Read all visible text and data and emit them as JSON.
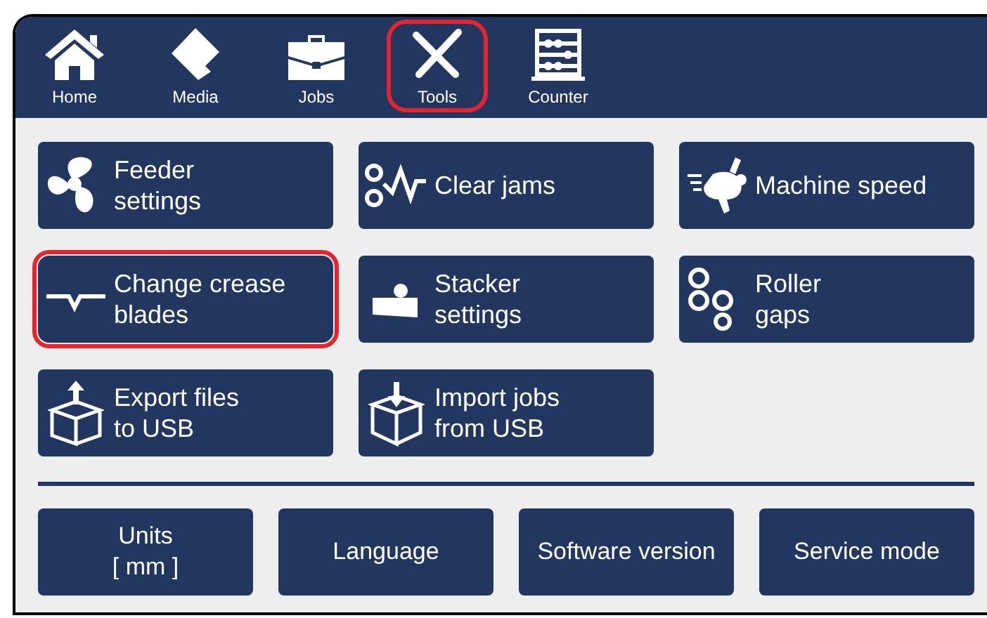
{
  "nav": [
    {
      "label": "Home",
      "highlighted": false
    },
    {
      "label": "Media",
      "highlighted": false
    },
    {
      "label": "Jobs",
      "highlighted": false
    },
    {
      "label": "Tools",
      "highlighted": true
    },
    {
      "label": "Counter",
      "highlighted": false
    }
  ],
  "tools": [
    {
      "lines": [
        "Feeder",
        "settings"
      ],
      "highlighted": false
    },
    {
      "lines": [
        "Clear jams"
      ],
      "highlighted": false
    },
    {
      "lines": [
        "Machine speed"
      ],
      "highlighted": false
    },
    {
      "lines": [
        "Change crease",
        "blades"
      ],
      "highlighted": true
    },
    {
      "lines": [
        "Stacker",
        "settings"
      ],
      "highlighted": false
    },
    {
      "lines": [
        "Roller",
        "gaps"
      ],
      "highlighted": false
    },
    {
      "lines": [
        "Export files",
        "to USB"
      ],
      "highlighted": false
    },
    {
      "lines": [
        "Import jobs",
        "from USB"
      ],
      "highlighted": false
    }
  ],
  "bottom_buttons": [
    {
      "lines": [
        "Units",
        "[ mm ]"
      ]
    },
    {
      "lines": [
        "Language"
      ]
    },
    {
      "lines": [
        "Software version"
      ]
    },
    {
      "lines": [
        "Service mode"
      ]
    }
  ]
}
